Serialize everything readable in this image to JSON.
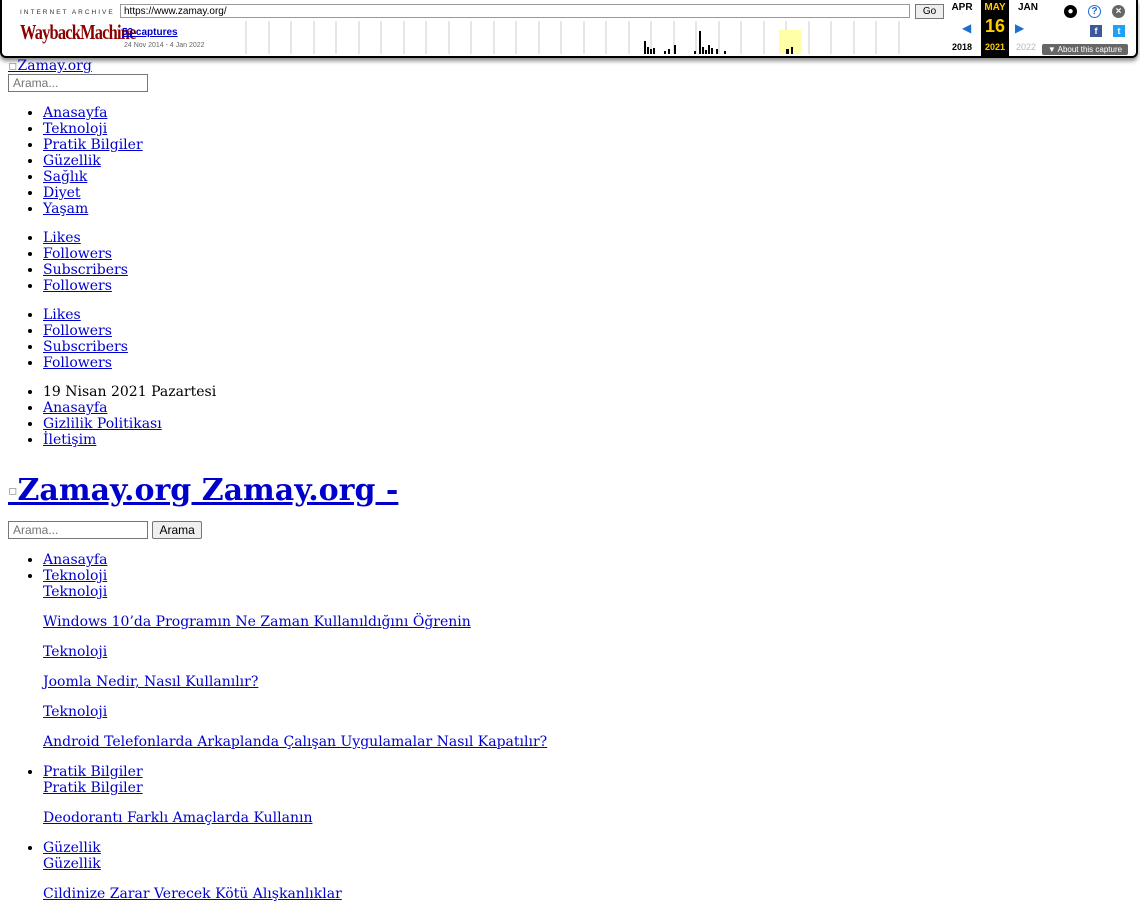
{
  "wayback": {
    "ia_text": "INTERNET ARCHIVE",
    "logo_text": "WaybackMachine",
    "url": "https://www.zamay.org/",
    "go_label": "Go",
    "captures": "53 captures",
    "range": "24 Nov 2014 - 4 Jan 2022",
    "prev_month": "APR",
    "cur_month": "MAY",
    "next_month": "JAN",
    "day": "16",
    "prev_year": "2018",
    "cur_year": "2021",
    "next_year": "2022",
    "about_label": "▼ About this capture",
    "accent": "#1a6fd1"
  },
  "header": {
    "logo_alt": "Zamay.org",
    "search_placeholder": "Arama..."
  },
  "nav": [
    "Anasayfa",
    "Teknoloji",
    "Pratik Bilgiler",
    "Güzellik",
    "Sağlık",
    "Diyet",
    "Yaşam"
  ],
  "social_a": [
    "Likes",
    "Followers",
    "Subscribers",
    "Followers"
  ],
  "social_b": [
    "Likes",
    "Followers",
    "Subscribers",
    "Followers"
  ],
  "topbar": {
    "date": "19 Nisan 2021 Pazartesi",
    "links": [
      "Anasayfa",
      "Gizlilik Politikası",
      "İletişim"
    ]
  },
  "site_title": "Zamay.org Zamay.org -",
  "search2": {
    "placeholder": "Arama...",
    "button": "Arama"
  },
  "menu": {
    "home": "Anasayfa",
    "teknoloji": {
      "label": "Teknoloji",
      "sub": "Teknoloji",
      "posts": [
        {
          "title": "Windows 10’da Programın Ne Zaman Kullanıldığını Öğrenin",
          "cat": "Teknoloji"
        },
        {
          "title": "Joomla Nedir, Nasıl Kullanılır?",
          "cat": "Teknoloji"
        },
        {
          "title": "Android Telefonlarda Arkaplanda Çalışan Uygulamalar Nasıl Kapatılır?",
          "cat": ""
        }
      ]
    },
    "pratik": {
      "label": "Pratik Bilgiler",
      "sub": "Pratik Bilgiler",
      "post": "Deodorantı Farklı Amaçlarda Kullanın"
    },
    "guzellik": {
      "label": "Güzellik",
      "sub": "Güzellik",
      "post": "Cildinize Zarar Verecek Kötü Alışkanlıklar"
    }
  }
}
